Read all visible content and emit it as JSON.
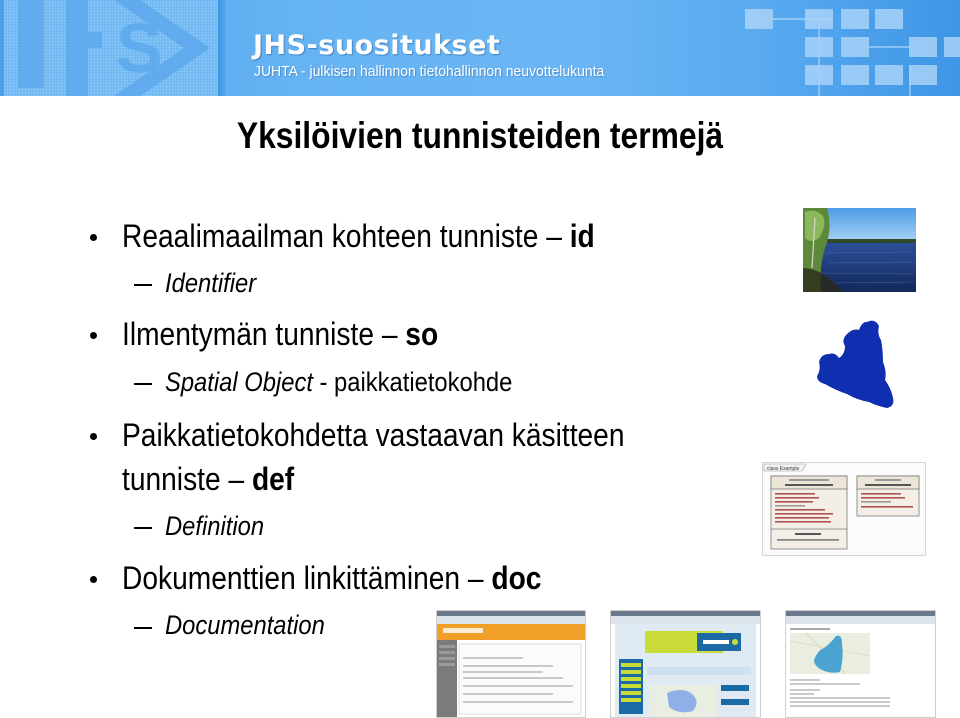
{
  "banner": {
    "logo_text": "JHS",
    "title": "JHS-suositukset",
    "subtitle": "JUHTA - julkisen hallinnon tietohallinnon neuvottelukunta",
    "colors": {
      "background": "#66b3f3",
      "text": "#ffffff"
    }
  },
  "slide": {
    "title": "Yksilöivien tunnisteiden termejä",
    "bullets": [
      {
        "text": "Reaalimaailman kohteen tunniste – ",
        "code": "id",
        "sub": {
          "italic": "Identifier",
          "rest": ""
        }
      },
      {
        "text": "Ilmentymän tunniste – ",
        "code": "so",
        "sub": {
          "italic": "Spatial Object",
          "rest": " - paikkatietokohde"
        }
      },
      {
        "text_line1": "Paikkatietokohdetta vastaavan käsitteen",
        "text_line2": "tunniste – ",
        "code": "def",
        "sub": {
          "italic": "Definition",
          "rest": ""
        }
      },
      {
        "text": "Dokumenttien linkittäminen – ",
        "code": "doc",
        "sub": {
          "italic": "Documentation",
          "rest": ""
        }
      }
    ]
  },
  "images": {
    "lake_photo": "lake-photo",
    "region_shape": "region-map-shape",
    "uml_diagram": {
      "frame_label": "class Example"
    },
    "screenshots": [
      "paikkatietoikkuna-screenshot",
      "ymparisto-map-screenshot",
      "lake-map-screenshot"
    ]
  },
  "colors": {
    "region_fill": "#0f2fb0",
    "text": "#000000"
  }
}
